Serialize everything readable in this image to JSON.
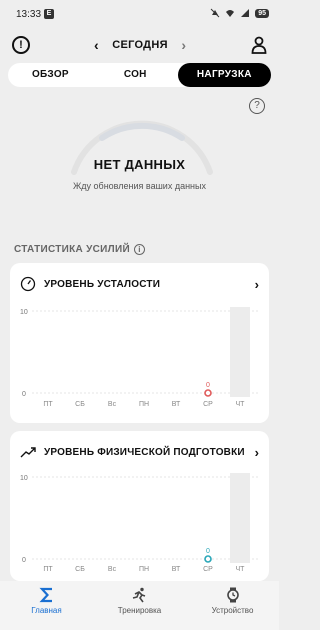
{
  "status_bar": {
    "time": "13:33",
    "notif_letter": "E",
    "battery": "95"
  },
  "header": {
    "date": "СЕГОДНЯ",
    "prev": "‹",
    "next": "›"
  },
  "tabs": [
    {
      "label": "ОБЗОР",
      "active": false
    },
    {
      "label": "СОН",
      "active": false
    },
    {
      "label": "НАГРУЗКА",
      "active": true
    }
  ],
  "load": {
    "status": "НЕТ ДАННЫХ",
    "waiting": "Жду обновления ваших данных"
  },
  "section_title": "СТАТИСТИКА УСИЛИЙ",
  "fatigue_card": {
    "title": "УРОВЕНЬ УСТАЛОСТИ",
    "chart_data": {
      "type": "scatter",
      "categories": [
        "ПТ",
        "СБ",
        "Вс",
        "ПН",
        "ВТ",
        "СР",
        "ЧТ"
      ],
      "y_ticks": [
        "10",
        "0"
      ],
      "ylim": [
        0,
        10
      ],
      "points": [
        {
          "category": "СР",
          "value": 0,
          "label": "0"
        }
      ],
      "highlight_category": "ЧТ",
      "point_color": "#e05a5a"
    }
  },
  "fitness_card": {
    "title": "УРОВЕНЬ ФИЗИЧЕСКОЙ ПОДГОТОВКИ",
    "chart_data": {
      "type": "scatter",
      "categories": [
        "ПТ",
        "СБ",
        "Вс",
        "ПН",
        "ВТ",
        "СР",
        "ЧТ"
      ],
      "y_ticks": [
        "10",
        "0"
      ],
      "ylim": [
        0,
        10
      ],
      "points": [
        {
          "category": "СР",
          "value": 0,
          "label": "0"
        }
      ],
      "highlight_category": "ЧТ",
      "point_color": "#2aa7b8"
    }
  },
  "bottom_nav": [
    {
      "label": "Главная",
      "icon": "sigma-icon",
      "active": true
    },
    {
      "label": "Тренировка",
      "icon": "runner-icon",
      "active": false
    },
    {
      "label": "Устройство",
      "icon": "watch-icon",
      "active": false
    }
  ],
  "colors": {
    "accent": "#1a6fd1",
    "active_tab_bg": "#000000"
  }
}
